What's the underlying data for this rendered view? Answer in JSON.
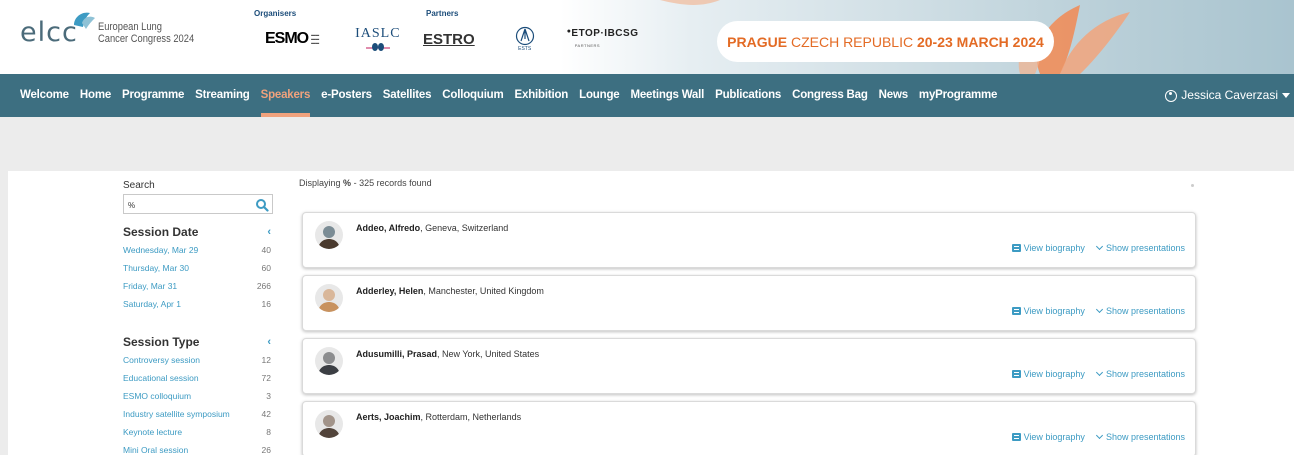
{
  "header": {
    "logo_word": "elcc",
    "logo_line1": "European Lung",
    "logo_line2": "Cancer Congress 2024",
    "organisers_label": "Organisers",
    "partners_label": "Partners",
    "esmo": "ESMO",
    "iaslc": "IASLC",
    "estro": "ESTRO",
    "ests": "ESTS",
    "etop": "ETOP·IBCSG",
    "etop_sub": "PARTNERS",
    "banner_city": "PRAGUE",
    "banner_country": "CZECH REPUBLIC",
    "banner_dates": "20-23 MARCH 2024"
  },
  "nav": {
    "items": [
      {
        "label": "Welcome"
      },
      {
        "label": "Home"
      },
      {
        "label": "Programme"
      },
      {
        "label": "Streaming"
      },
      {
        "label": "Speakers",
        "active": true
      },
      {
        "label": "e-Posters"
      },
      {
        "label": "Satellites"
      },
      {
        "label": "Colloquium"
      },
      {
        "label": "Exhibition"
      },
      {
        "label": "Lounge"
      },
      {
        "label": "Meetings Wall"
      },
      {
        "label": "Publications"
      },
      {
        "label": "Congress Bag"
      },
      {
        "label": "News"
      },
      {
        "label": "myProgramme"
      }
    ],
    "user_name": "Jessica Caverzasi"
  },
  "sidebar": {
    "search_label": "Search",
    "search_value": "%",
    "session_date": {
      "title": "Session Date",
      "items": [
        {
          "label": "Wednesday, Mar 29",
          "count": "40"
        },
        {
          "label": "Thursday, Mar 30",
          "count": "60"
        },
        {
          "label": "Friday, Mar 31",
          "count": "266"
        },
        {
          "label": "Saturday, Apr 1",
          "count": "16"
        }
      ]
    },
    "session_type": {
      "title": "Session Type",
      "items": [
        {
          "label": "Controversy session",
          "count": "12"
        },
        {
          "label": "Educational session",
          "count": "72"
        },
        {
          "label": "ESMO colloquium",
          "count": "3"
        },
        {
          "label": "Industry satellite symposium",
          "count": "42"
        },
        {
          "label": "Keynote lecture",
          "count": "8"
        },
        {
          "label": "Mini Oral session",
          "count": "26"
        }
      ]
    }
  },
  "results": {
    "displaying_prefix": "Displaying",
    "query": "%",
    "suffix": "- 325 records found",
    "view_biography": "View biography",
    "show_presentations": "Show presentations",
    "speakers": [
      {
        "name": "Addeo, Alfredo",
        "location": ", Geneva, Switzerland"
      },
      {
        "name": "Adderley, Helen",
        "location": ", Manchester, United Kingdom"
      },
      {
        "name": "Adusumilli, Prasad",
        "location": ", New York, United States"
      },
      {
        "name": "Aerts, Joachim",
        "location": ", Rotterdam, Netherlands"
      }
    ]
  },
  "colors": {
    "nav_bg": "#3d6f81",
    "active": "#f0a27d",
    "link": "#3d9bc3",
    "banner_orange": "#e36b25"
  }
}
